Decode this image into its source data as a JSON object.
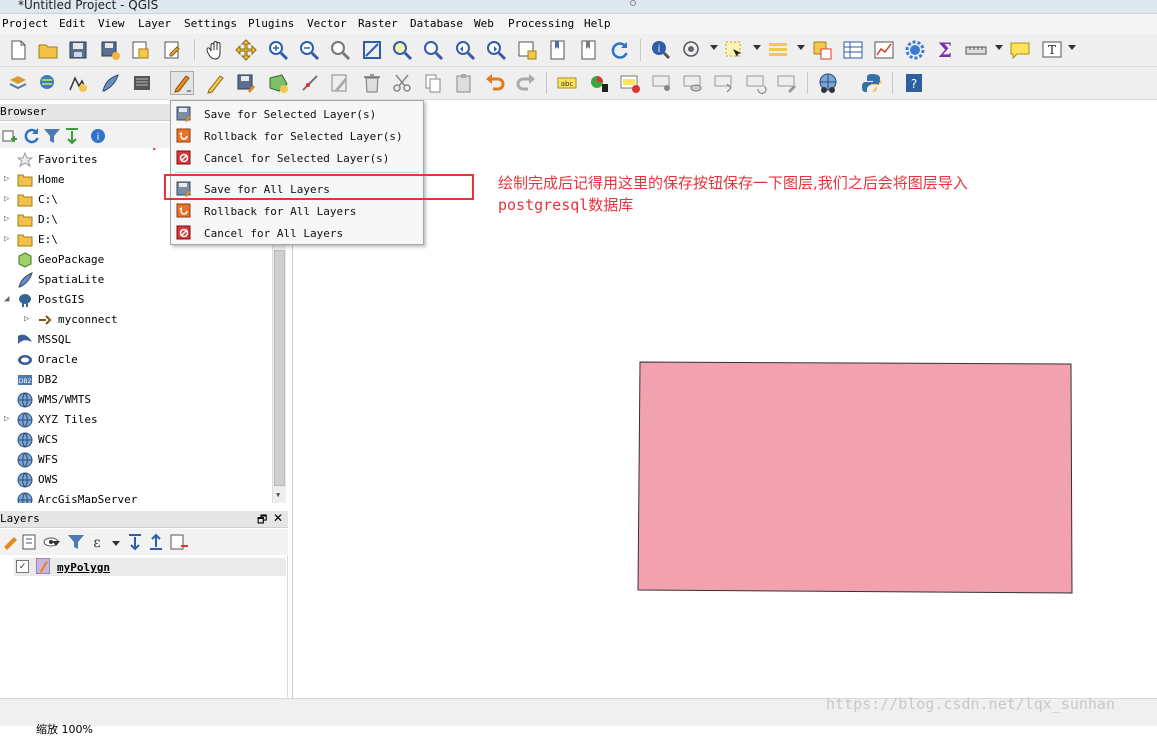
{
  "window": {
    "title": "*Untitled Project - QGIS"
  },
  "menu": [
    "Project",
    "Edit",
    "View",
    "Layer",
    "Settings",
    "Plugins",
    "Vector",
    "Raster",
    "Database",
    "Web",
    "Processing",
    "Help"
  ],
  "browser_panel": {
    "title": "Browser",
    "items": [
      {
        "label": "Favorites",
        "icon": "star-icon",
        "expandable": false
      },
      {
        "label": "Home",
        "icon": "folder-icon",
        "expandable": true
      },
      {
        "label": "C:\\",
        "icon": "folder-icon",
        "expandable": true
      },
      {
        "label": "D:\\",
        "icon": "folder-icon",
        "expandable": true
      },
      {
        "label": "E:\\",
        "icon": "folder-icon",
        "expandable": true
      },
      {
        "label": "GeoPackage",
        "icon": "geopackage-icon",
        "expandable": false
      },
      {
        "label": "SpatiaLite",
        "icon": "feather-icon",
        "expandable": false
      },
      {
        "label": "PostGIS",
        "icon": "elephant-icon",
        "expandable": true,
        "expanded": true
      },
      {
        "label": "myconnect",
        "icon": "connection-icon",
        "expandable": true,
        "indent": true
      },
      {
        "label": "MSSQL",
        "icon": "mssql-icon",
        "expandable": false
      },
      {
        "label": "Oracle",
        "icon": "oracle-icon",
        "expandable": false
      },
      {
        "label": "DB2",
        "icon": "db2-icon",
        "expandable": false
      },
      {
        "label": "WMS/WMTS",
        "icon": "globe-icon",
        "expandable": false
      },
      {
        "label": "XYZ Tiles",
        "icon": "globe-icon",
        "expandable": true
      },
      {
        "label": "WCS",
        "icon": "globe-icon",
        "expandable": false
      },
      {
        "label": "WFS",
        "icon": "globe-icon",
        "expandable": false
      },
      {
        "label": "OWS",
        "icon": "globe-icon",
        "expandable": false
      },
      {
        "label": "ArcGisMapServer",
        "icon": "globe-icon",
        "expandable": false
      }
    ]
  },
  "layers_panel": {
    "title": "Layers",
    "layers": [
      {
        "name": "myPolygn",
        "checked": true,
        "checkmark": "✓"
      }
    ]
  },
  "edits_menu": {
    "items": [
      {
        "label": "Save for Selected Layer(s)",
        "icon": "save-selected-icon"
      },
      {
        "label": "Rollback for Selected Layer(s)",
        "icon": "rollback-selected-icon"
      },
      {
        "label": "Cancel for Selected Layer(s)",
        "icon": "cancel-selected-icon"
      },
      {
        "label": "Save for All Layers",
        "icon": "save-all-icon"
      },
      {
        "label": "Rollback for All Layers",
        "icon": "rollback-all-icon"
      },
      {
        "label": "Cancel for All Layers",
        "icon": "cancel-all-icon"
      }
    ]
  },
  "annotation": {
    "line1": "绘制完成后记得用这里的保存按钮保存一下图层,我们之后会将图层导入",
    "line2": "postgresql数据库"
  },
  "polygon": {
    "fill": "#f2a2ae",
    "stroke": "#333333"
  },
  "statusbar": {
    "text": "缩放 100%"
  },
  "watermark": "https://blog.csdn.net/lqx_sunhan",
  "colors": {
    "annotation_red": "#e8333b",
    "polygon_fill": "#f2a2ae"
  }
}
